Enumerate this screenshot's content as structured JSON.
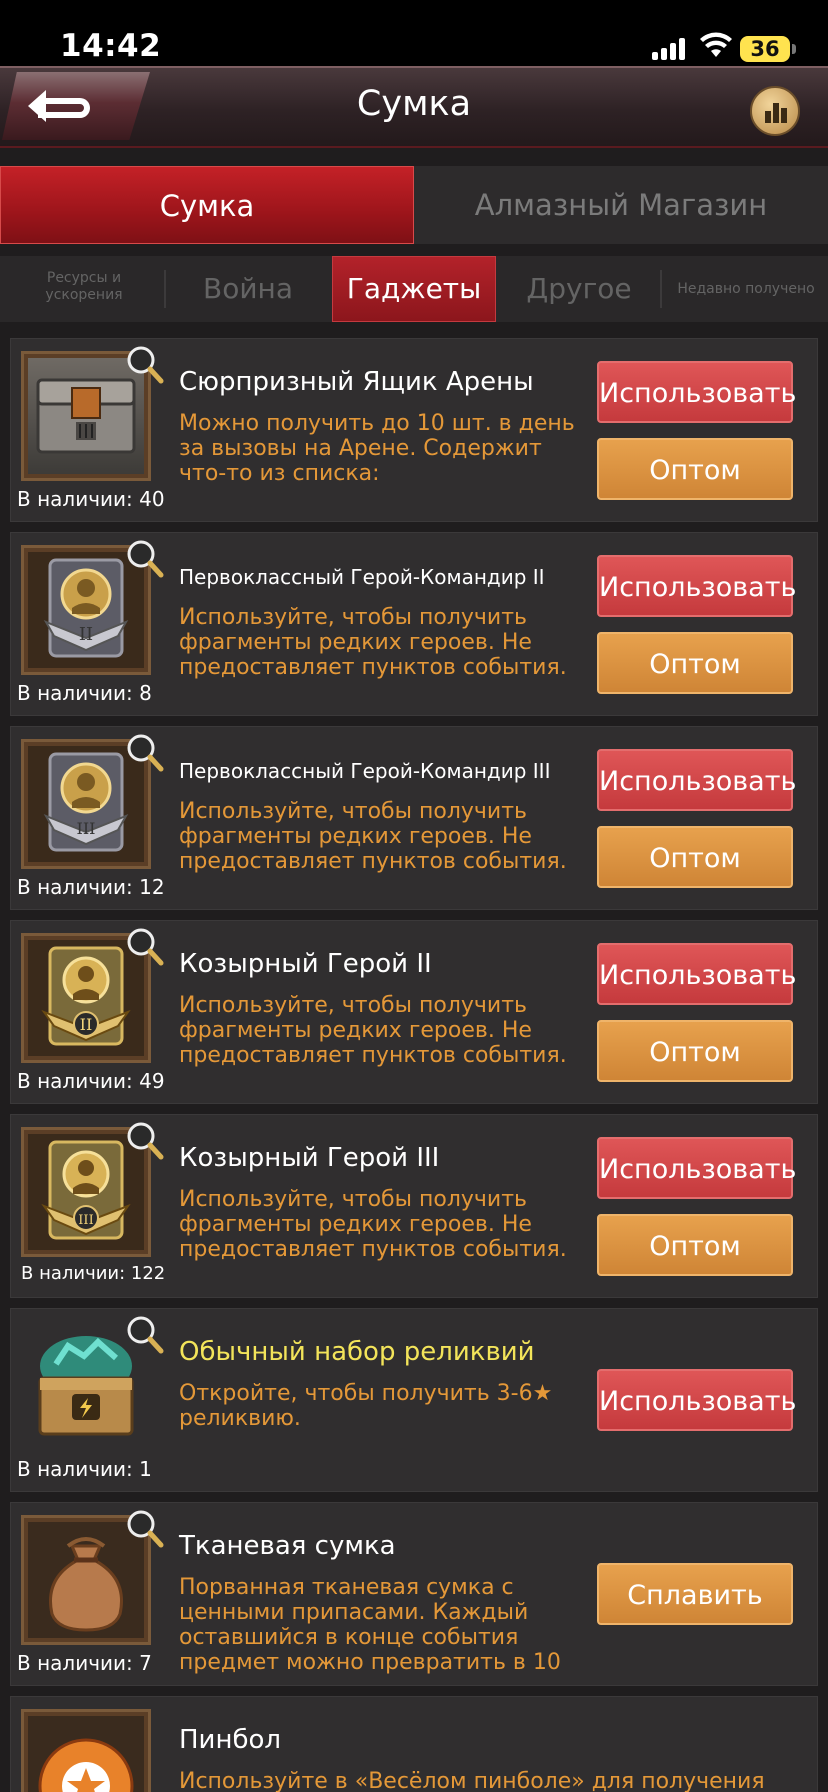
{
  "status_bar": {
    "time": "14:42",
    "battery": "36"
  },
  "header": {
    "title": "Сумка"
  },
  "main_tabs": [
    {
      "label": "Сумка"
    },
    {
      "label": "Алмазный Магазин"
    }
  ],
  "sub_tabs": [
    {
      "label": "Ресурсы и ускорения"
    },
    {
      "label": "Война"
    },
    {
      "label": "Гаджеты"
    },
    {
      "label": "Другое"
    },
    {
      "label": "Недавно получено"
    }
  ],
  "items": [
    {
      "title": "Сюрпризный Ящик Арены",
      "desc": "Можно получить до 10 шт. в день за вызовы на Арене. Содержит что-то из списка:",
      "stock": "В наличии: 40",
      "primary_btn": "Использовать",
      "secondary_btn": "Оптом",
      "icon": "arena-chest-icon"
    },
    {
      "title": "Первоклассный Герой-Командир II",
      "desc": "Используйте, чтобы получить фрагменты редких героев. Не предоставляет пунктов события.",
      "stock": "В наличии: 8",
      "primary_btn": "Использовать",
      "secondary_btn": "Оптом",
      "icon": "hero-commander-medal-icon"
    },
    {
      "title": "Первоклассный Герой-Командир III",
      "desc": "Используйте, чтобы получить фрагменты редких героев. Не предоставляет пунктов события.",
      "stock": "В наличии: 12",
      "primary_btn": "Использовать",
      "secondary_btn": "Оптом",
      "icon": "hero-commander-medal-icon"
    },
    {
      "title": "Козырный Герой II",
      "desc": "Используйте, чтобы получить фрагменты редких героев. Не предоставляет пунктов события.",
      "stock": "В наличии: 49",
      "primary_btn": "Использовать",
      "secondary_btn": "Оптом",
      "icon": "trump-hero-medal-icon"
    },
    {
      "title": "Козырный Герой III",
      "desc": "Используйте, чтобы получить фрагменты редких героев. Не предоставляет пунктов события.",
      "stock": "В наличии: 122",
      "primary_btn": "Использовать",
      "secondary_btn": "Оптом",
      "icon": "trump-hero-medal-icon"
    },
    {
      "title": "Обычный набор реликвий",
      "desc": "Откройте, чтобы получить 3-6★ реликвию.",
      "stock": "В наличии: 1",
      "primary_btn": "Использовать",
      "icon": "relic-chest-icon"
    },
    {
      "title": "Тканевая сумка",
      "desc": "Порванная тканевая сумка с ценными припасами. Каждый оставшийся в конце события предмет можно превратить в 10",
      "stock": "В наличии: 7",
      "primary_btn": "Сплавить",
      "icon": "cloth-bag-icon"
    },
    {
      "title": "Пинбол",
      "desc": "Используйте в «Весёлом пинболе» для получения",
      "icon": "pinball-icon"
    }
  ],
  "colors": {
    "accent_red": "#c42127",
    "use_button": "#d94a4c",
    "bulk_button": "#df9440",
    "desc_text": "#e49838",
    "highlight_title": "#f3e45a"
  }
}
